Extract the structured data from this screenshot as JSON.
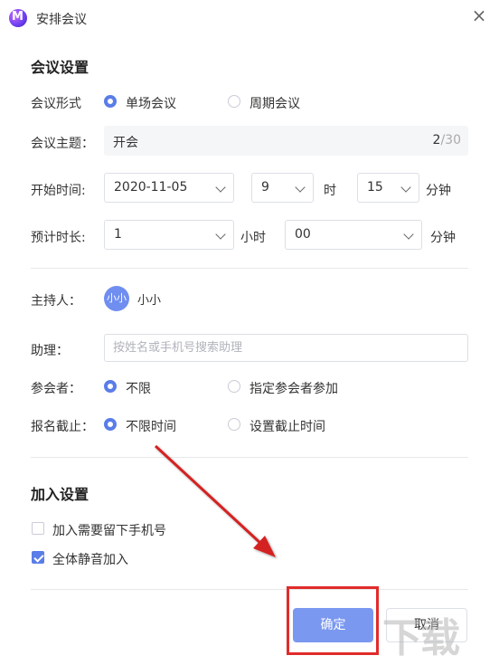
{
  "window": {
    "title": "安排会议",
    "close_glyph": "×"
  },
  "meeting_settings": {
    "section_title": "会议设置",
    "format": {
      "label": "会议形式",
      "options": [
        {
          "label": "单场会议",
          "checked": true
        },
        {
          "label": "周期会议",
          "checked": false
        }
      ]
    },
    "topic": {
      "label": "会议主题：",
      "value": "开会",
      "count": "2",
      "max": "/30"
    },
    "start_time": {
      "label": "开始时间:",
      "date": "2020-11-05",
      "hour": "9",
      "hour_unit": "时",
      "minute": "15",
      "minute_unit": "分钟"
    },
    "duration": {
      "label": "预计时长:",
      "hours": "1",
      "hours_unit": "小时",
      "minutes": "00",
      "minutes_unit": "分钟"
    },
    "host": {
      "label": "主持人：",
      "avatar_text": "小小",
      "name": "小小"
    },
    "assistant": {
      "label": "助理：",
      "placeholder": "按姓名或手机号搜索助理"
    },
    "participants": {
      "label": "参会者：",
      "options": [
        {
          "label": "不限",
          "checked": true
        },
        {
          "label": "指定参会者参加",
          "checked": false
        }
      ]
    },
    "deadline": {
      "label": "报名截止：",
      "options": [
        {
          "label": "不限时间",
          "checked": true
        },
        {
          "label": "设置截止时间",
          "checked": false
        }
      ]
    }
  },
  "join_settings": {
    "section_title": "加入设置",
    "options": [
      {
        "label": "加入需要留下手机号",
        "checked": false
      },
      {
        "label": "全体静音加入",
        "checked": true
      }
    ]
  },
  "footer": {
    "confirm_label": "确定",
    "cancel_label": "取消"
  },
  "annotation": {
    "highlight_color": "#e12b2b"
  },
  "watermark": {
    "text": "下载吧"
  },
  "colors": {
    "accent": "#5a7de8",
    "button": "#7b98f0"
  }
}
